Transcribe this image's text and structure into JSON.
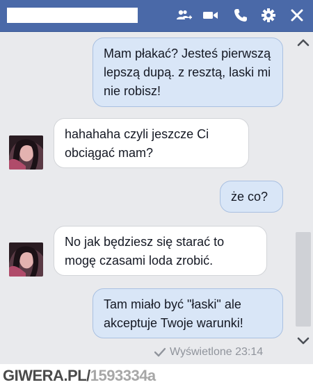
{
  "header": {
    "icons": [
      "add-friend-icon",
      "video-call-icon",
      "phone-icon",
      "gear-icon",
      "close-icon"
    ]
  },
  "messages": [
    {
      "side": "out",
      "text": "Mam płakać? Jesteś pierwszą lepszą dupą. z resztą, laski mi nie robisz!"
    },
    {
      "side": "in",
      "text": "hahahaha czyli jeszcze Ci obciągać mam?"
    },
    {
      "side": "out",
      "text": "że co?"
    },
    {
      "side": "in",
      "text": "No jak będziesz się starać to mogę czasami loda zrobić."
    },
    {
      "side": "out",
      "text": "Tam miało być \"łaski\" ale akceptuje Twoje warunki!"
    }
  ],
  "seen_status": "Wyświetlone 23:14",
  "watermark": {
    "site": "GIWERA.PL/",
    "id": "1593334a"
  },
  "colors": {
    "header": "#4a69a8",
    "chat_background": "#e9eaed",
    "outgoing_bubble": "#d9e6f7",
    "incoming_bubble": "#ffffff"
  }
}
